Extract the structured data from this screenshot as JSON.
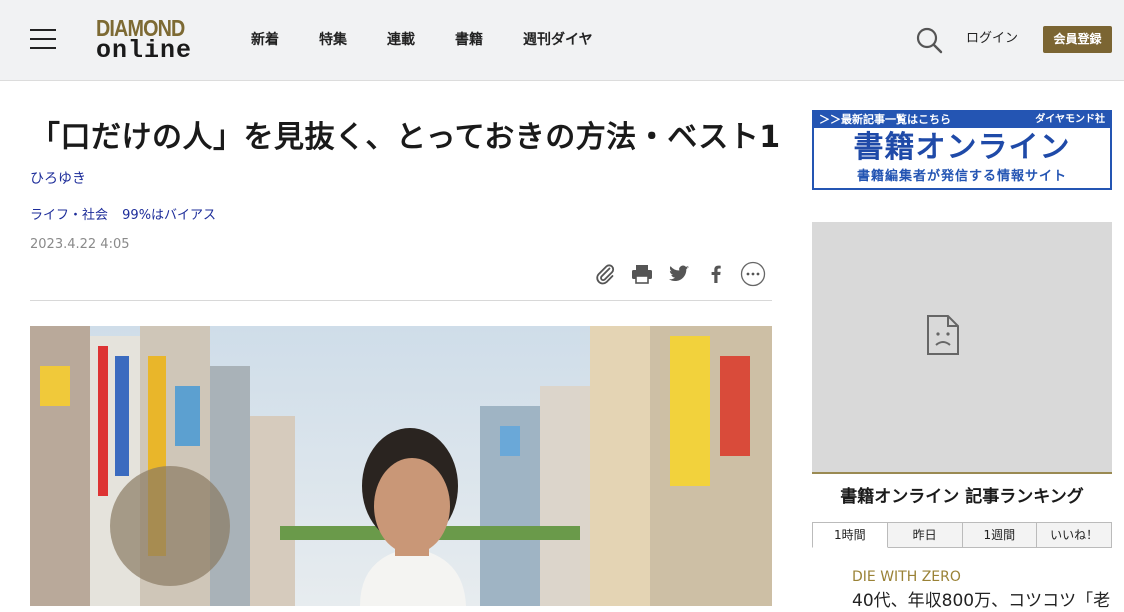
{
  "header": {
    "logo_top": "DIAMOND",
    "logo_bottom": "online",
    "nav": [
      "新着",
      "特集",
      "連載",
      "書籍",
      "週刊ダイヤ"
    ],
    "login": "ログイン",
    "register": "会員登録"
  },
  "article": {
    "title": "「口だけの人」を見抜く、とっておきの方法・ベスト1",
    "author": "ひろゆき",
    "tags": [
      "ライフ・社会",
      "99%はバイアス"
    ],
    "date": "2023.4.22 4:05",
    "share_icons": [
      "paperclip-icon",
      "print-icon",
      "twitter-icon",
      "facebook-icon",
      "more-icon"
    ]
  },
  "sidebar": {
    "banner_top_left": "＞＞最新記事一覧はこちら",
    "banner_top_right": "ダイヤモンド社",
    "banner_main": "書籍オンライン",
    "banner_sub": "書籍編集者が発信する情報サイト",
    "ranking_title": "書籍オンライン 記事ランキング",
    "tabs": [
      "1時間",
      "昨日",
      "1週間",
      "いいね！"
    ],
    "active_tab": "1時間",
    "first_item_category": "DIE WITH ZERO",
    "first_item_title": "40代、年収800万、コツコツ「老"
  },
  "colors": {
    "header_bg": "#f1f2f3",
    "brand_gold": "#7b6532",
    "link_blue": "#1d2d9a",
    "banner_blue": "#2455b3"
  }
}
